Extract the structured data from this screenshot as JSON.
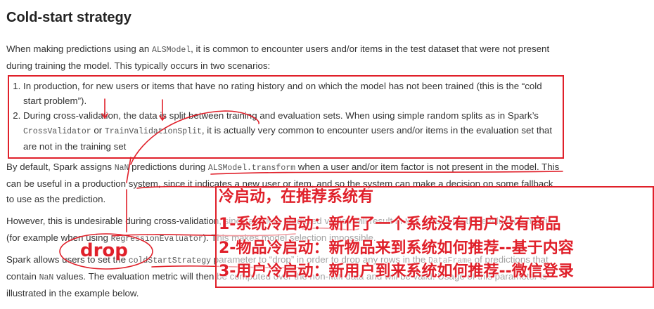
{
  "heading": "Cold-start strategy",
  "intro": {
    "part1": "When making predictions using an ",
    "code1": "ALSModel",
    "part2": ", it is common to encounter users and/or items in the test dataset that were not present during training the model. This typically occurs in two scenarios:"
  },
  "scenarios": [
    {
      "text": "In production, for new users or items that have no rating history and on which the model has not been trained (this is the “cold start problem”)."
    },
    {
      "part1": "During cross-validation, the data is split between training and evaluation sets. When using simple random splits as in Spark’s ",
      "code1": "CrossValidator",
      "part2": " or ",
      "code2": "TrainValidationSplit",
      "part3": ", it is actually very common to encounter users and/or items in the evaluation set that are not in the training set"
    }
  ],
  "default_para": {
    "part1": "By default, Spark assigns ",
    "code1": "NaN",
    "part2": " predictions during ",
    "code2": "ALSModel.transform",
    "part3": " when a user and/or item factor is not present in the model. This can be useful in a production system, since it indicates a new user or item, and so the system can make a decision on some fallback to use as the prediction."
  },
  "however_para": {
    "part1": "However, this is undesirable during cross-validation, since any ",
    "code1": "NaN",
    "part2": " predicted values will result in ",
    "code2": "NaN",
    "part3": " results for the evaluation metric (for example when using ",
    "code3": "RegressionEvaluator",
    "part4": "). This makes model selection impossible."
  },
  "allows_para": {
    "part1": "Spark allows users to set the ",
    "code1": "coldStartStrategy",
    "part2": " parameter to “drop” in order to drop any rows in the ",
    "code2": "DataFrame",
    "part3": " of predictions that contain ",
    "code3": "NaN",
    "part4": " values. The evaluation metric will then be computed over the non-",
    "code4": "NaN",
    "part5": " data and will be valid. Usage of this parameter is illustrated in the example below."
  },
  "annotations": {
    "drop_label": "drop",
    "notes": [
      "冷启动，在推荐系统有",
      "1-系统冷启动：新作了一个系统没有用户没有商品",
      "2-物品冷启动：新物品来到系统如何推荐--基于内容",
      "3-用户冷启动：新用户到来系统如何推荐--微信登录"
    ],
    "ink_color": "#e0202a"
  }
}
